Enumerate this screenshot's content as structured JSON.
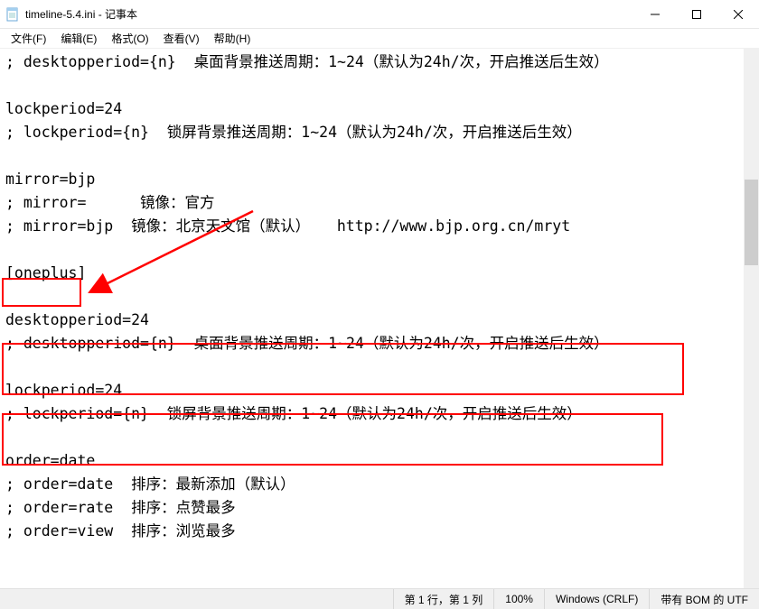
{
  "titlebar": {
    "title": "timeline-5.4.ini - 记事本"
  },
  "menu": {
    "file": "文件(F)",
    "edit": "编辑(E)",
    "format": "格式(O)",
    "view": "查看(V)",
    "help": "帮助(H)"
  },
  "lines": {
    "l1": "; desktopperiod={n}  桌面背景推送周期：1~24（默认为24h/次，开启推送后生效）",
    "l2": "",
    "l3": "lockperiod=24",
    "l4": "; lockperiod={n}  锁屏背景推送周期：1~24（默认为24h/次，开启推送后生效）",
    "l5": "",
    "l6": "mirror=bjp",
    "l7": "; mirror=      镜像：官方",
    "l8": "; mirror=bjp  镜像：北京天文馆（默认）   http://www.bjp.org.cn/mryt",
    "l9": "",
    "l10": "[oneplus]",
    "l11": "",
    "l12": "desktopperiod=24",
    "l13": "; desktopperiod={n}  桌面背景推送周期：1~24（默认为24h/次，开启推送后生效）",
    "l14": "",
    "l15": "lockperiod=24",
    "l16": "; lockperiod={n}  锁屏背景推送周期：1~24（默认为24h/次，开启推送后生效）",
    "l17": "",
    "l18": "order=date",
    "l19": "; order=date  排序：最新添加（默认）",
    "l20": "; order=rate  排序：点赞最多",
    "l21": "; order=view  排序：浏览最多"
  },
  "status": {
    "pos": "第 1 行，第 1 列",
    "zoom": "100%",
    "eol": "Windows (CRLF)",
    "enc": "带有 BOM 的 UTF"
  }
}
